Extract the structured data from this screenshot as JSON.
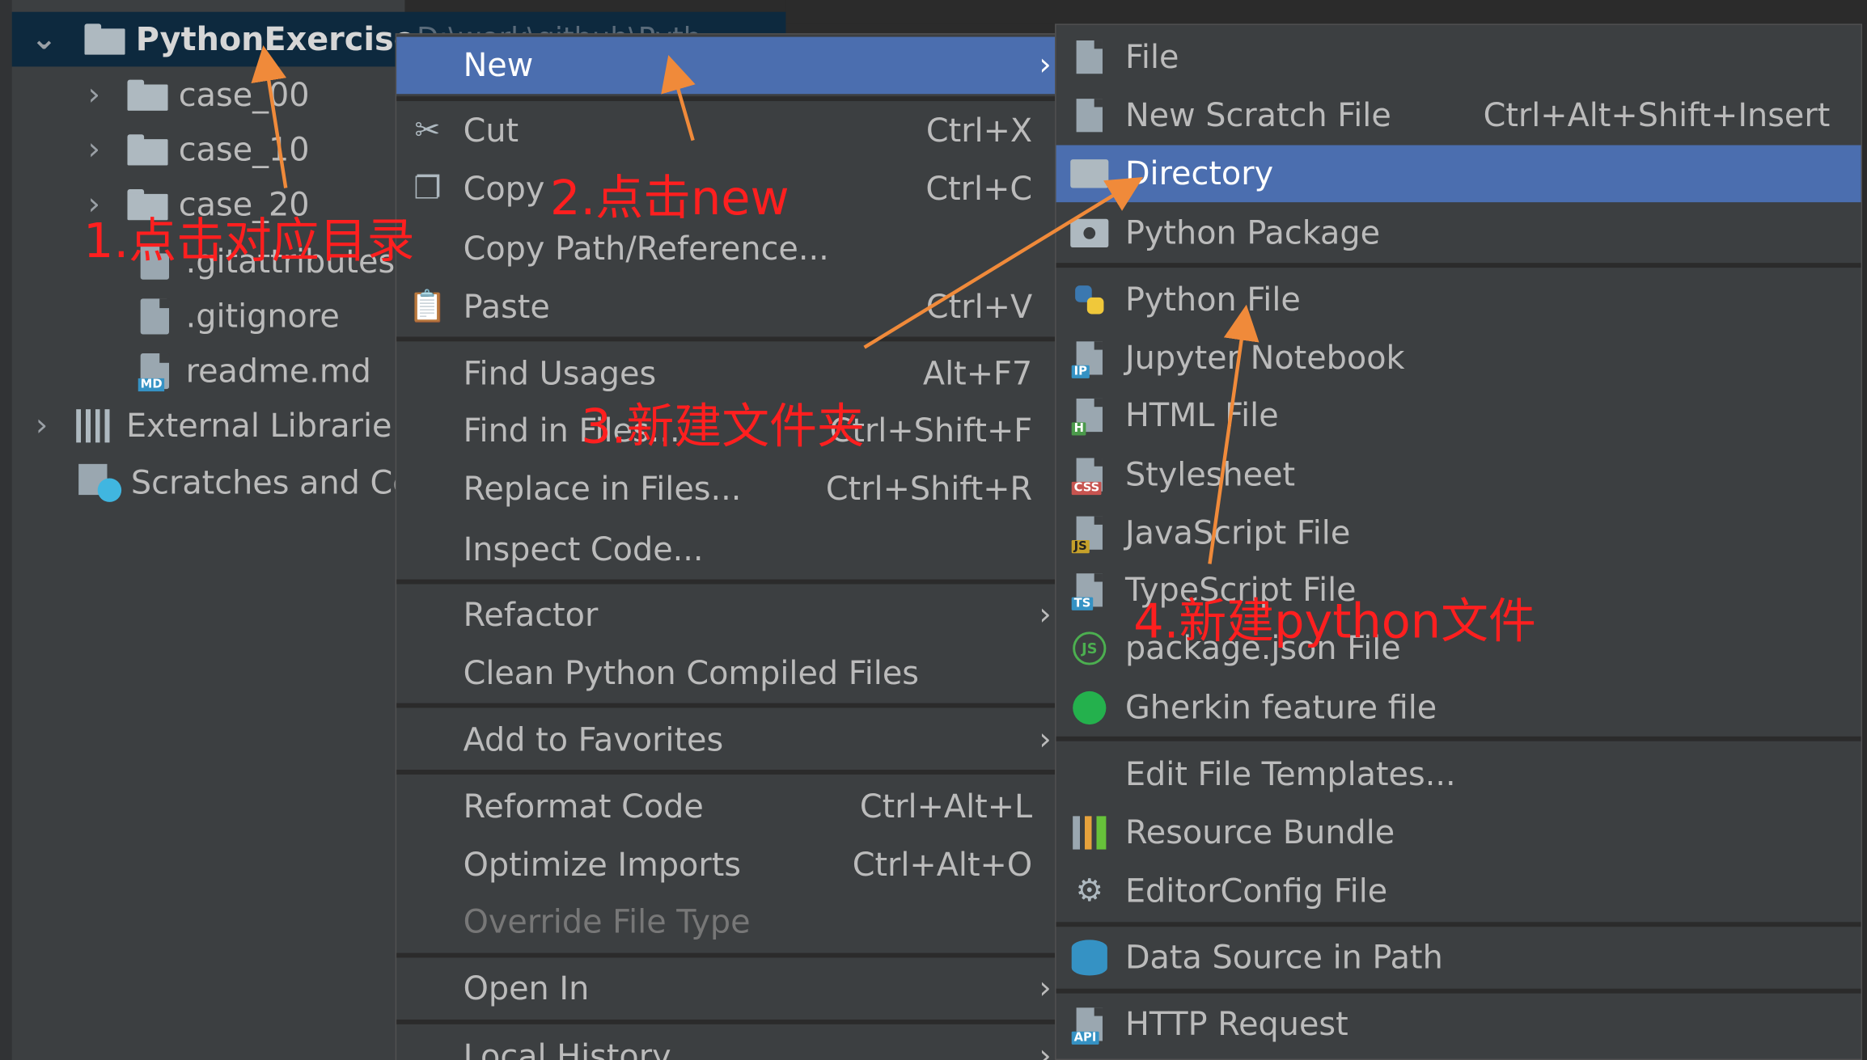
{
  "tree": {
    "root": {
      "label": "PythonExercise",
      "path": "D:\\work\\github\\Pyth..."
    },
    "items": [
      {
        "label": "case_00",
        "type": "folder"
      },
      {
        "label": "case_10",
        "type": "folder"
      },
      {
        "label": "case_20",
        "type": "folder"
      },
      {
        "label": ".gitattributes",
        "type": "file"
      },
      {
        "label": ".gitignore",
        "type": "file"
      },
      {
        "label": "readme.md",
        "type": "markdown",
        "badge": "MD"
      }
    ],
    "external_libraries": "External Librarie",
    "scratches": "Scratches and Co"
  },
  "context_menu": {
    "new": "New",
    "cut": {
      "label": "Cut",
      "shortcut": "Ctrl+X"
    },
    "copy": {
      "label": "Copy",
      "shortcut": "Ctrl+C"
    },
    "copy_path": "Copy Path/Reference...",
    "paste": {
      "label": "Paste",
      "shortcut": "Ctrl+V"
    },
    "find_usages": {
      "label": "Find Usages",
      "shortcut": "Alt+F7"
    },
    "find_in_files": {
      "label": "Find in Files...",
      "shortcut": "Ctrl+Shift+F"
    },
    "replace_in_files": {
      "label": "Replace in Files...",
      "shortcut": "Ctrl+Shift+R"
    },
    "inspect_code": "Inspect Code...",
    "refactor": "Refactor",
    "clean_python": "Clean Python Compiled Files",
    "add_favorites": "Add to Favorites",
    "reformat": {
      "label": "Reformat Code",
      "shortcut": "Ctrl+Alt+L"
    },
    "optimize_imports": {
      "label": "Optimize Imports",
      "shortcut": "Ctrl+Alt+O"
    },
    "override_file_type": "Override File Type",
    "open_in": "Open In",
    "local_history": "Local History"
  },
  "new_submenu": {
    "file": "File",
    "scratch": {
      "label": "New Scratch File",
      "shortcut": "Ctrl+Alt+Shift+Insert"
    },
    "directory": "Directory",
    "python_package": "Python Package",
    "python_file": "Python File",
    "jupyter": {
      "label": "Jupyter Notebook",
      "badge": "IP"
    },
    "html": {
      "label": "HTML File",
      "badge": "H"
    },
    "stylesheet": {
      "label": "Stylesheet",
      "badge": "CSS"
    },
    "javascript": {
      "label": "JavaScript File",
      "badge": "JS"
    },
    "typescript": {
      "label": "TypeScript File",
      "badge": "TS"
    },
    "package_json": {
      "label": "package.json File",
      "badge": "JS"
    },
    "gherkin": "Gherkin feature file",
    "edit_templates": "Edit File Templates...",
    "resource_bundle": "Resource Bundle",
    "editorconfig": "EditorConfig File",
    "data_source": "Data Source in Path",
    "http_request": {
      "label": "HTTP Request",
      "badge": "API"
    }
  },
  "annotations": {
    "step1": "1.点击对应目录",
    "step2": "2.点击new",
    "step3": "3.新建文件夹",
    "step4": "4.新建python文件"
  },
  "colors": {
    "selection": "#4b6eaf",
    "menu_bg": "#3c3f41",
    "annotation_text": "#ff1f1f",
    "annotation_arrow": "#f08a3a"
  }
}
